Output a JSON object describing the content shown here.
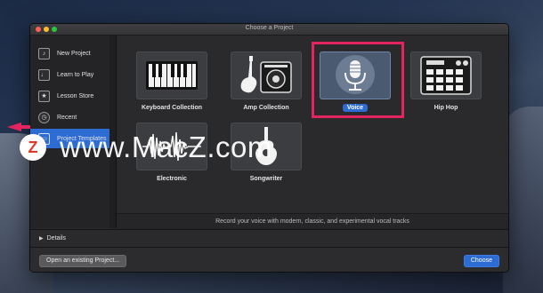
{
  "window": {
    "title": "Choose a Project"
  },
  "sidebar": {
    "items": [
      {
        "label": "New Project",
        "icon": "new-project-icon",
        "glyph": "♪",
        "selected": false
      },
      {
        "label": "Learn to Play",
        "icon": "learn-to-play-icon",
        "glyph": "♩",
        "selected": false
      },
      {
        "label": "Lesson Store",
        "icon": "lesson-store-icon",
        "glyph": "★",
        "selected": false
      },
      {
        "label": "Recent",
        "icon": "recent-icon",
        "glyph": "◷",
        "selected": false
      },
      {
        "label": "Project Templates",
        "icon": "folder-icon",
        "glyph": "▭",
        "selected": true
      }
    ]
  },
  "templates": [
    {
      "label": "Keyboard Collection",
      "icon": "keyboard-icon",
      "selected": false
    },
    {
      "label": "Amp Collection",
      "icon": "guitar-amp-icon",
      "selected": false
    },
    {
      "label": "Voice",
      "icon": "microphone-icon",
      "selected": true
    },
    {
      "label": "Hip Hop",
      "icon": "drum-machine-icon",
      "selected": false
    },
    {
      "label": "Electronic",
      "icon": "waveform-icon",
      "selected": false
    },
    {
      "label": "Songwriter",
      "icon": "acoustic-guitar-icon",
      "selected": false
    }
  ],
  "description": "Record your voice with modern, classic, and experimental vocal tracks",
  "details": {
    "label": "Details"
  },
  "footer": {
    "open_existing_label": "Open an existing Project...",
    "choose_label": "Choose"
  },
  "watermark": {
    "text": "www.MacZ.com",
    "logo_letter": "Z"
  },
  "colors": {
    "accent": "#2d6cd3",
    "highlight": "#e2245f",
    "arrow": "#e2245f"
  }
}
